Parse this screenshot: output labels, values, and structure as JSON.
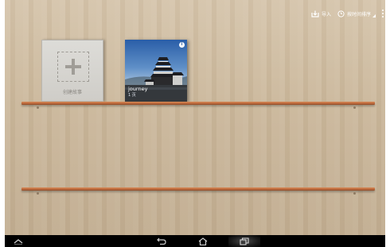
{
  "toolbar": {
    "import_label": "导入",
    "sort_label": "按时间排序",
    "import_icon": "download-tray-icon",
    "sort_icon": "clock-icon",
    "menu_icon": "overflow-menu-icon"
  },
  "books": {
    "new_book_label": "创建故事",
    "new_book_icon": "add-plus-icon",
    "photo_book": {
      "title": "journey",
      "subtitle": "1 页",
      "cover": "castle-photo"
    }
  },
  "navbar": {
    "icons": [
      "collapse-chevron-icon",
      "back-icon",
      "home-icon",
      "recent-apps-icon"
    ]
  },
  "colors": {
    "shelf": "#b9663a",
    "wall": "#cbb89c",
    "navbar": "#000000",
    "accent_blue": "#2a5ea8"
  }
}
